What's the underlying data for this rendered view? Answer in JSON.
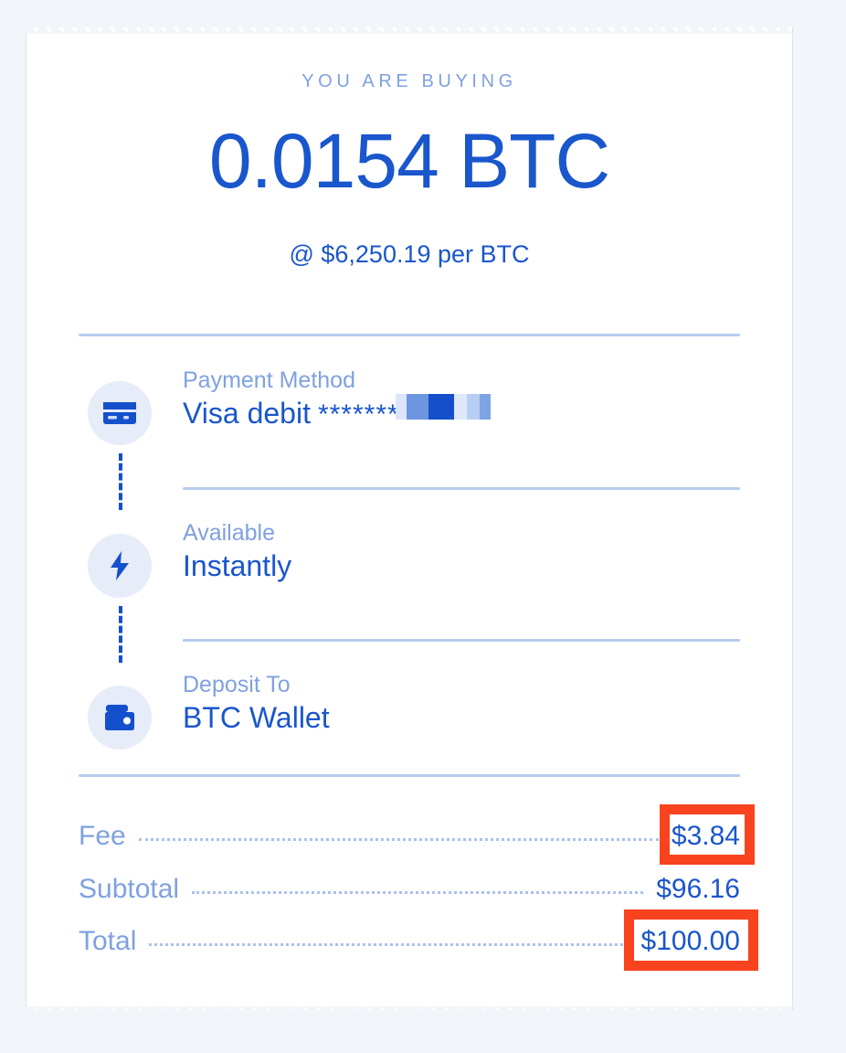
{
  "theme": {
    "page_background": "#f2f5f9",
    "card_background": "#ffffff",
    "accent_blue": "#1a56cc",
    "muted_blue": "#7fa1e0",
    "divider_blue": "#b6cced",
    "icon_bubble": "#e6ecf8",
    "annotation_red": "#f9431f"
  },
  "header": {
    "kicker": "YOU ARE BUYING",
    "amount": "0.0154 BTC",
    "rate": "@ $6,250.19 per BTC"
  },
  "steps": [
    {
      "icon": "credit-card-icon",
      "label": "Payment Method",
      "value": "Visa debit",
      "masked_digits": "*******",
      "redacted": true
    },
    {
      "icon": "lightning-bolt-icon",
      "label": "Available",
      "value": "Instantly",
      "redacted": false
    },
    {
      "icon": "wallet-icon",
      "label": "Deposit To",
      "value": "BTC Wallet",
      "redacted": false
    }
  ],
  "totals": [
    {
      "label": "Fee",
      "value": "$3.84",
      "highlighted": true
    },
    {
      "label": "Subtotal",
      "value": "$96.16",
      "highlighted": false
    },
    {
      "label": "Total",
      "value": "$100.00",
      "highlighted": true
    }
  ]
}
